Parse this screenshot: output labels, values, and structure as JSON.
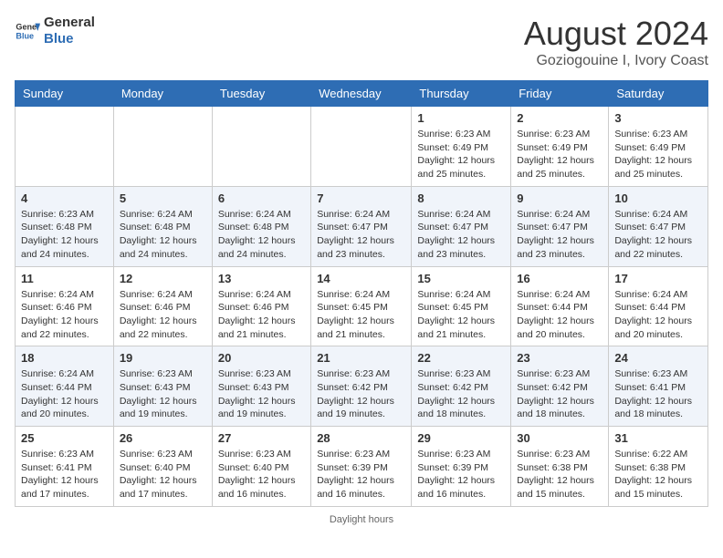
{
  "header": {
    "logo_line1": "General",
    "logo_line2": "Blue",
    "month": "August 2024",
    "location": "Goziogouine I, Ivory Coast"
  },
  "days_of_week": [
    "Sunday",
    "Monday",
    "Tuesday",
    "Wednesday",
    "Thursday",
    "Friday",
    "Saturday"
  ],
  "weeks": [
    [
      {
        "day": "",
        "info": ""
      },
      {
        "day": "",
        "info": ""
      },
      {
        "day": "",
        "info": ""
      },
      {
        "day": "",
        "info": ""
      },
      {
        "day": "1",
        "info": "Sunrise: 6:23 AM\nSunset: 6:49 PM\nDaylight: 12 hours and 25 minutes."
      },
      {
        "day": "2",
        "info": "Sunrise: 6:23 AM\nSunset: 6:49 PM\nDaylight: 12 hours and 25 minutes."
      },
      {
        "day": "3",
        "info": "Sunrise: 6:23 AM\nSunset: 6:49 PM\nDaylight: 12 hours and 25 minutes."
      }
    ],
    [
      {
        "day": "4",
        "info": "Sunrise: 6:23 AM\nSunset: 6:48 PM\nDaylight: 12 hours and 24 minutes."
      },
      {
        "day": "5",
        "info": "Sunrise: 6:24 AM\nSunset: 6:48 PM\nDaylight: 12 hours and 24 minutes."
      },
      {
        "day": "6",
        "info": "Sunrise: 6:24 AM\nSunset: 6:48 PM\nDaylight: 12 hours and 24 minutes."
      },
      {
        "day": "7",
        "info": "Sunrise: 6:24 AM\nSunset: 6:47 PM\nDaylight: 12 hours and 23 minutes."
      },
      {
        "day": "8",
        "info": "Sunrise: 6:24 AM\nSunset: 6:47 PM\nDaylight: 12 hours and 23 minutes."
      },
      {
        "day": "9",
        "info": "Sunrise: 6:24 AM\nSunset: 6:47 PM\nDaylight: 12 hours and 23 minutes."
      },
      {
        "day": "10",
        "info": "Sunrise: 6:24 AM\nSunset: 6:47 PM\nDaylight: 12 hours and 22 minutes."
      }
    ],
    [
      {
        "day": "11",
        "info": "Sunrise: 6:24 AM\nSunset: 6:46 PM\nDaylight: 12 hours and 22 minutes."
      },
      {
        "day": "12",
        "info": "Sunrise: 6:24 AM\nSunset: 6:46 PM\nDaylight: 12 hours and 22 minutes."
      },
      {
        "day": "13",
        "info": "Sunrise: 6:24 AM\nSunset: 6:46 PM\nDaylight: 12 hours and 21 minutes."
      },
      {
        "day": "14",
        "info": "Sunrise: 6:24 AM\nSunset: 6:45 PM\nDaylight: 12 hours and 21 minutes."
      },
      {
        "day": "15",
        "info": "Sunrise: 6:24 AM\nSunset: 6:45 PM\nDaylight: 12 hours and 21 minutes."
      },
      {
        "day": "16",
        "info": "Sunrise: 6:24 AM\nSunset: 6:44 PM\nDaylight: 12 hours and 20 minutes."
      },
      {
        "day": "17",
        "info": "Sunrise: 6:24 AM\nSunset: 6:44 PM\nDaylight: 12 hours and 20 minutes."
      }
    ],
    [
      {
        "day": "18",
        "info": "Sunrise: 6:24 AM\nSunset: 6:44 PM\nDaylight: 12 hours and 20 minutes."
      },
      {
        "day": "19",
        "info": "Sunrise: 6:23 AM\nSunset: 6:43 PM\nDaylight: 12 hours and 19 minutes."
      },
      {
        "day": "20",
        "info": "Sunrise: 6:23 AM\nSunset: 6:43 PM\nDaylight: 12 hours and 19 minutes."
      },
      {
        "day": "21",
        "info": "Sunrise: 6:23 AM\nSunset: 6:42 PM\nDaylight: 12 hours and 19 minutes."
      },
      {
        "day": "22",
        "info": "Sunrise: 6:23 AM\nSunset: 6:42 PM\nDaylight: 12 hours and 18 minutes."
      },
      {
        "day": "23",
        "info": "Sunrise: 6:23 AM\nSunset: 6:42 PM\nDaylight: 12 hours and 18 minutes."
      },
      {
        "day": "24",
        "info": "Sunrise: 6:23 AM\nSunset: 6:41 PM\nDaylight: 12 hours and 18 minutes."
      }
    ],
    [
      {
        "day": "25",
        "info": "Sunrise: 6:23 AM\nSunset: 6:41 PM\nDaylight: 12 hours and 17 minutes."
      },
      {
        "day": "26",
        "info": "Sunrise: 6:23 AM\nSunset: 6:40 PM\nDaylight: 12 hours and 17 minutes."
      },
      {
        "day": "27",
        "info": "Sunrise: 6:23 AM\nSunset: 6:40 PM\nDaylight: 12 hours and 16 minutes."
      },
      {
        "day": "28",
        "info": "Sunrise: 6:23 AM\nSunset: 6:39 PM\nDaylight: 12 hours and 16 minutes."
      },
      {
        "day": "29",
        "info": "Sunrise: 6:23 AM\nSunset: 6:39 PM\nDaylight: 12 hours and 16 minutes."
      },
      {
        "day": "30",
        "info": "Sunrise: 6:23 AM\nSunset: 6:38 PM\nDaylight: 12 hours and 15 minutes."
      },
      {
        "day": "31",
        "info": "Sunrise: 6:22 AM\nSunset: 6:38 PM\nDaylight: 12 hours and 15 minutes."
      }
    ]
  ],
  "footer": "Daylight hours"
}
